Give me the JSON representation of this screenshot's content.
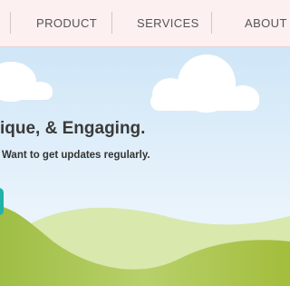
{
  "nav": {
    "items": [
      {
        "label": "PRODUCT"
      },
      {
        "label": "SERVICES"
      },
      {
        "label": "ABOUT"
      }
    ]
  },
  "hero": {
    "headline": "ique, & Engaging.",
    "subline": "Want to get updates regularly."
  },
  "colors": {
    "nav_bg": "#fcf0f0",
    "sky_top": "#cfe6f7",
    "hill_dark": "#a6c04a",
    "hill_light": "#d6e6a8",
    "cta": "#1fb2a8"
  }
}
